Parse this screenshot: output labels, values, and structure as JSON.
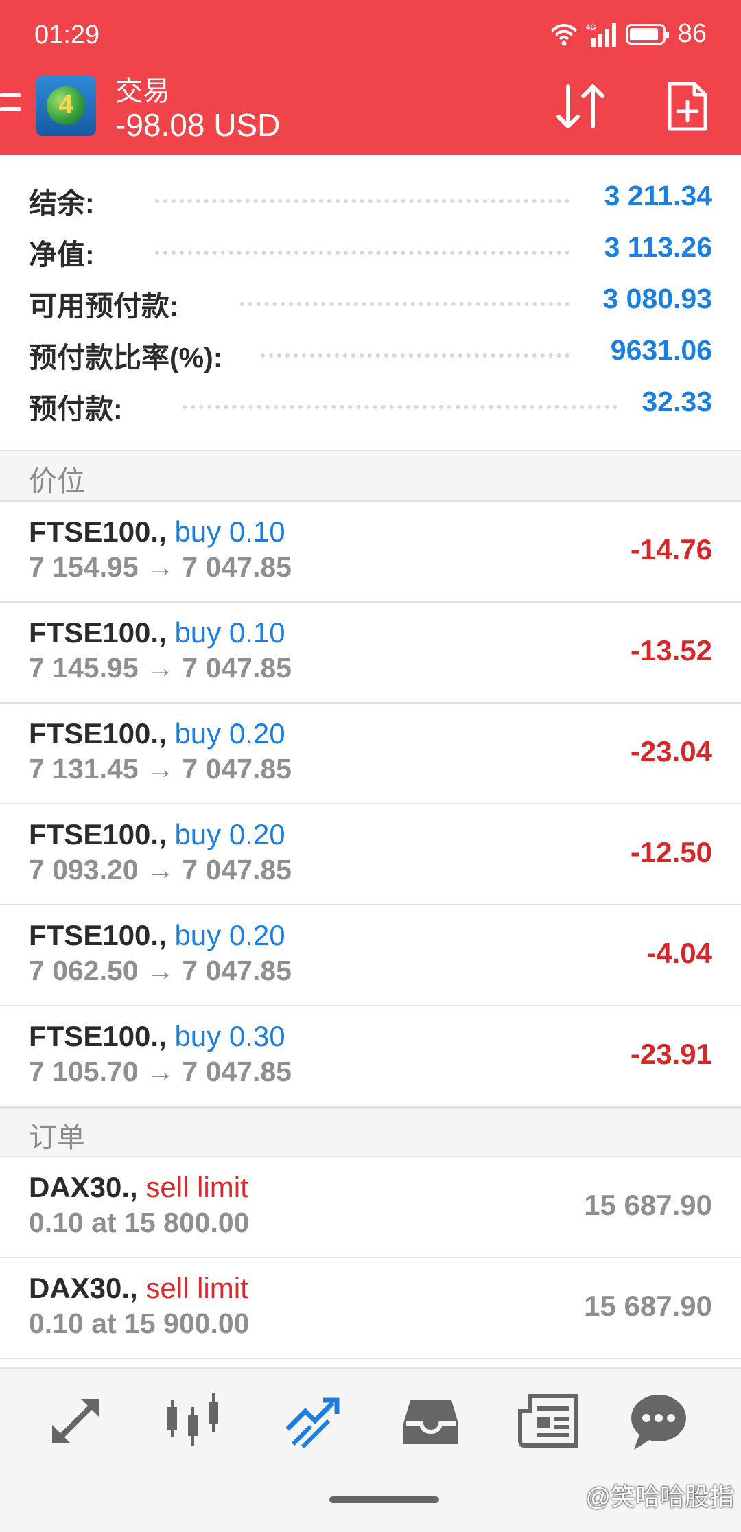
{
  "status": {
    "time": "01:29",
    "battery": "86",
    "network": "4G"
  },
  "app_bar": {
    "title": "交易",
    "balance_line": "-98.08 USD"
  },
  "summary": [
    {
      "label": "结余:",
      "value": "3 211.34"
    },
    {
      "label": "净值:",
      "value": "3 113.26"
    },
    {
      "label": "可用预付款:",
      "value": "3 080.93"
    },
    {
      "label": "预付款比率(%):",
      "value": "9631.06"
    },
    {
      "label": "预付款:",
      "value": "32.33"
    }
  ],
  "positions_header": "价位",
  "positions": [
    {
      "symbol": "FTSE100.,",
      "side": "buy 0.10",
      "prices": "7 154.95 → 7 047.85",
      "profit": "-14.76"
    },
    {
      "symbol": "FTSE100.,",
      "side": "buy 0.10",
      "prices": "7 145.95 → 7 047.85",
      "profit": "-13.52"
    },
    {
      "symbol": "FTSE100.,",
      "side": "buy 0.20",
      "prices": "7 131.45 → 7 047.85",
      "profit": "-23.04"
    },
    {
      "symbol": "FTSE100.,",
      "side": "buy 0.20",
      "prices": "7 093.20 → 7 047.85",
      "profit": "-12.50"
    },
    {
      "symbol": "FTSE100.,",
      "side": "buy 0.20",
      "prices": "7 062.50 → 7 047.85",
      "profit": "-4.04"
    },
    {
      "symbol": "FTSE100.,",
      "side": "buy 0.30",
      "prices": "7 105.70 → 7 047.85",
      "profit": "-23.91"
    }
  ],
  "orders_header": "订单",
  "orders": [
    {
      "symbol": "DAX30.,",
      "side": "sell limit",
      "detail": "0.10 at 15 800.00",
      "current": "15 687.90"
    },
    {
      "symbol": "DAX30.,",
      "side": "sell limit",
      "detail": "0.10 at 15 900.00",
      "current": "15 687.90"
    }
  ],
  "bottom_nav": {
    "items": [
      "quotes-icon",
      "chart-icon",
      "trade-icon",
      "history-icon",
      "news-icon",
      "chat-icon"
    ],
    "active": "trade-icon",
    "active_color": "#1b7fe0",
    "inactive_color": "#666666"
  },
  "watermark": "@笑哈哈股指",
  "colors": {
    "accent_red": "#f0434a",
    "value_blue": "#1b7fe0",
    "loss_red": "#d9262b"
  }
}
